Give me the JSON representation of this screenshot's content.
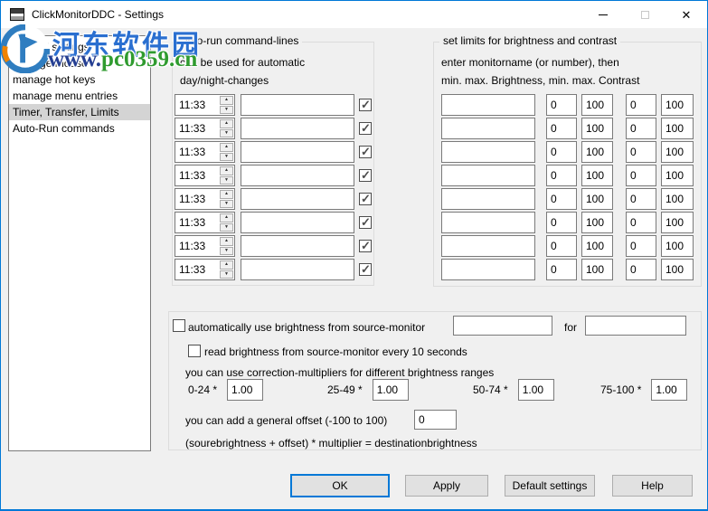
{
  "window": {
    "title": "ClickMonitorDDC - Settings",
    "controls": {
      "close_glyph": "✕"
    }
  },
  "watermark": {
    "site_name": "河东软件园",
    "url_www": "www.",
    "url_domain": "pc0359.cn",
    "colors": {
      "name_blue": "#2a6fd0",
      "url_green": "#2f9b2f",
      "logo_blue": "#2f7dc0",
      "logo_orange": "#f08300"
    }
  },
  "sidebar": {
    "items": [
      {
        "label": "general settings",
        "selected": false
      },
      {
        "label": "manage mouse",
        "selected": false
      },
      {
        "label": "manage hot keys",
        "selected": false
      },
      {
        "label": "manage menu entries",
        "selected": false
      },
      {
        "label": "Timer, Transfer, Limits",
        "selected": true
      },
      {
        "label": "Auto-Run commands",
        "selected": false
      }
    ]
  },
  "auto_run": {
    "legend": "auto-run command-lines",
    "description_line1": "can be used for automatic",
    "description_line2": "day/night-changes",
    "icons": {
      "spin_up": "▲",
      "spin_down": "▼"
    },
    "rows": [
      {
        "time": "11:33",
        "command": "",
        "enabled": true
      },
      {
        "time": "11:33",
        "command": "",
        "enabled": true
      },
      {
        "time": "11:33",
        "command": "",
        "enabled": true
      },
      {
        "time": "11:33",
        "command": "",
        "enabled": true
      },
      {
        "time": "11:33",
        "command": "",
        "enabled": true
      },
      {
        "time": "11:33",
        "command": "",
        "enabled": true
      },
      {
        "time": "11:33",
        "command": "",
        "enabled": true
      },
      {
        "time": "11:33",
        "command": "",
        "enabled": true
      }
    ]
  },
  "limits": {
    "legend": "set limits for brightness and contrast",
    "description_line1": "enter monitorname (or number), then",
    "description_line2": "min. max. Brightness, min. max. Contrast",
    "rows": [
      {
        "monitor": "",
        "min_brightness": "0",
        "max_brightness": "100",
        "min_contrast": "0",
        "max_contrast": "100"
      },
      {
        "monitor": "",
        "min_brightness": "0",
        "max_brightness": "100",
        "min_contrast": "0",
        "max_contrast": "100"
      },
      {
        "monitor": "",
        "min_brightness": "0",
        "max_brightness": "100",
        "min_contrast": "0",
        "max_contrast": "100"
      },
      {
        "monitor": "",
        "min_brightness": "0",
        "max_brightness": "100",
        "min_contrast": "0",
        "max_contrast": "100"
      },
      {
        "monitor": "",
        "min_brightness": "0",
        "max_brightness": "100",
        "min_contrast": "0",
        "max_contrast": "100"
      },
      {
        "monitor": "",
        "min_brightness": "0",
        "max_brightness": "100",
        "min_contrast": "0",
        "max_contrast": "100"
      },
      {
        "monitor": "",
        "min_brightness": "0",
        "max_brightness": "100",
        "min_contrast": "0",
        "max_contrast": "100"
      },
      {
        "monitor": "",
        "min_brightness": "0",
        "max_brightness": "100",
        "min_contrast": "0",
        "max_contrast": "100"
      }
    ]
  },
  "transfer": {
    "auto_use_label": "automatically use brightness from source-monitor",
    "auto_use_checked": false,
    "source_value": "",
    "for_label": "for",
    "dest_value": "",
    "read_every_label": "read brightness from source-monitor every 10 seconds",
    "read_every_checked": false,
    "multipliers_heading": "you can use correction-multipliers for different brightness ranges",
    "multipliers": [
      {
        "range": "0-24 *",
        "value": "1.00"
      },
      {
        "range": "25-49 *",
        "value": "1.00"
      },
      {
        "range": "50-74 *",
        "value": "1.00"
      },
      {
        "range": "75-100 *",
        "value": "1.00"
      }
    ],
    "offset_label": "you can add a general offset (-100 to 100)",
    "offset_value": "0",
    "formula": "(sourebrightness + offset) * multiplier = destinationbrightness"
  },
  "footer": {
    "ok": "OK",
    "apply": "Apply",
    "default_settings": "Default settings",
    "help": "Help"
  }
}
